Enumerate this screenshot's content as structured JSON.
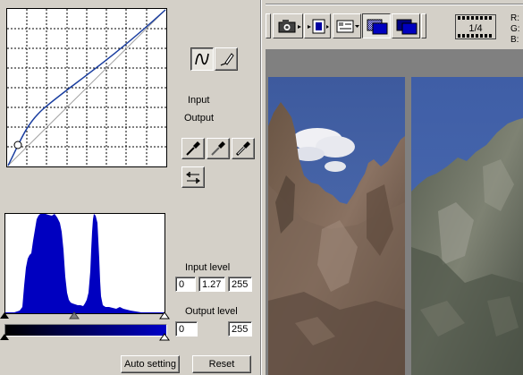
{
  "curves_panel": {
    "input_label": "Input",
    "output_label": "Output"
  },
  "levels_panel": {
    "input_level_label": "Input level",
    "input_black": "0",
    "input_gamma": "1.27",
    "input_white": "255",
    "output_level_label": "Output level",
    "output_black": "0",
    "output_white": "255"
  },
  "buttons": {
    "auto_setting": "Auto setting",
    "reset": "Reset"
  },
  "toolbar": {
    "frame_counter": "1/4"
  },
  "pixel_readout": {
    "r_label": "R:",
    "g_label": "G:",
    "b_label": "B:"
  },
  "colors": {
    "curve": "#1a3ea0",
    "histogram": "#0000c0",
    "panel": "#d4d0c8"
  },
  "icons": {
    "curve_mode": "smooth-curve-icon",
    "freehand_mode": "freehand-pencil-icon",
    "black_point": "black-eyedropper-icon",
    "gray_point": "gray-eyedropper-icon",
    "white_point": "white-eyedropper-icon",
    "set_curve": "curve-adjust-icon"
  }
}
